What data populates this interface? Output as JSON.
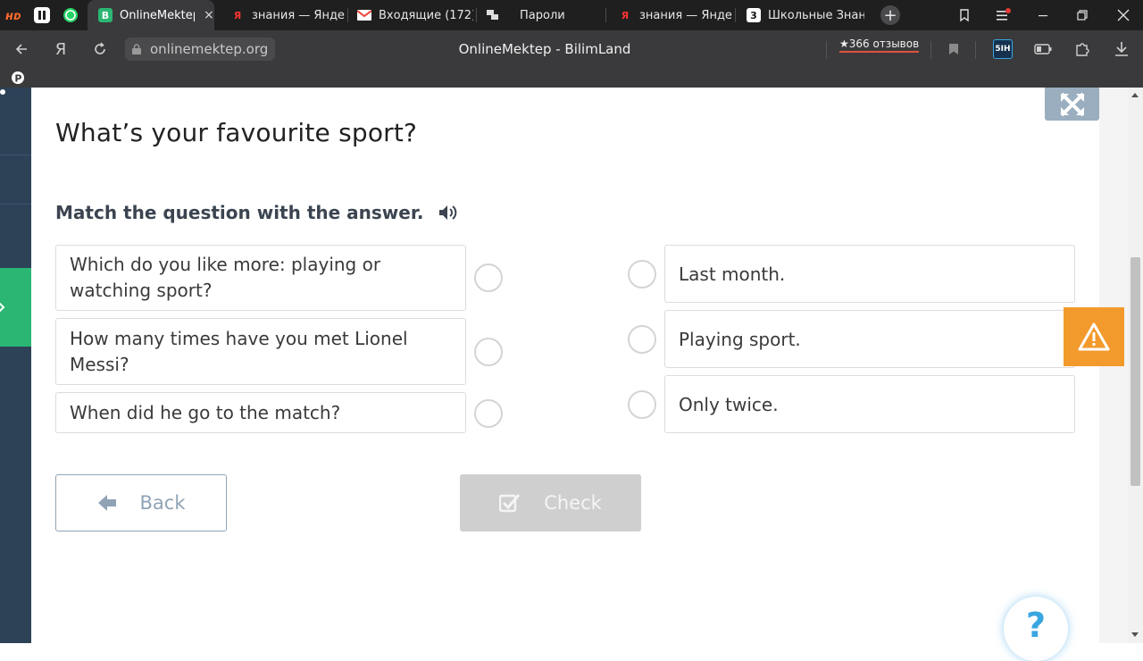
{
  "browser": {
    "tabs": [
      {
        "label": "OnlineMektep",
        "active": true
      },
      {
        "label": "знания — Яндекс"
      },
      {
        "label": "Входящие (172) -"
      },
      {
        "label": "Пароли"
      },
      {
        "label": "знания — Яндекс"
      },
      {
        "label": "Школьные Знания"
      }
    ],
    "tab_close": "×",
    "new_tab": "+",
    "url": "onlinemektep.org",
    "page_title": "OnlineMektep - BilimLand",
    "reviews": "★366 отзывов",
    "yandex_letter": "Я",
    "ext_badge": "5IH"
  },
  "exercise": {
    "title": "What’s your favourite sport?",
    "instruction": "Match the question with the answer.",
    "questions": [
      "Which do you like more: playing or watching sport?",
      "How many times have you met Lionel Messi?",
      "When did he go to the match?"
    ],
    "answers": [
      "Last month.",
      "Playing sport.",
      "Only twice."
    ],
    "back_label": "Back",
    "check_label": "Check",
    "help_label": "?"
  },
  "colors": {
    "accent_green": "#2bb673",
    "warning_orange": "#f39a2d",
    "check_disabled": "#cfcfcf",
    "back_border": "#8fa3b5"
  }
}
